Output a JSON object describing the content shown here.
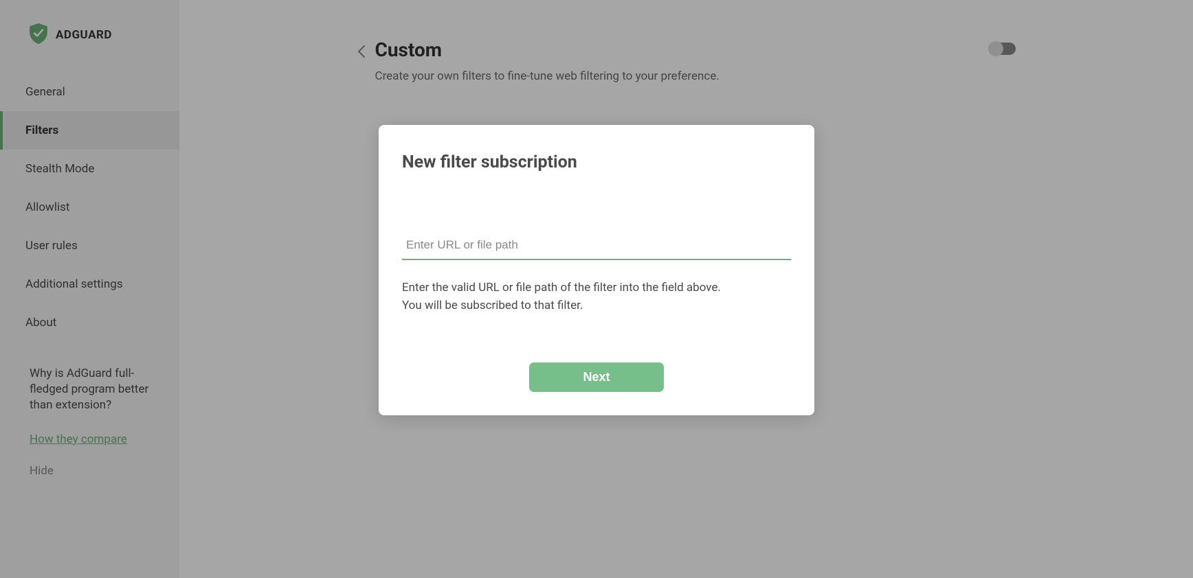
{
  "brand": {
    "name": "ADGUARD"
  },
  "sidebar": {
    "items": [
      {
        "label": "General"
      },
      {
        "label": "Filters"
      },
      {
        "label": "Stealth Mode"
      },
      {
        "label": "Allowlist"
      },
      {
        "label": "User rules"
      },
      {
        "label": "Additional settings"
      },
      {
        "label": "About"
      }
    ],
    "promo": {
      "text": "Why is AdGuard full-fledged program better than extension?",
      "compare_link": "How they compare",
      "hide_label": "Hide"
    }
  },
  "header": {
    "title": "Custom",
    "subtitle": "Create your own filters to fine-tune web filtering to your preference."
  },
  "modal": {
    "title": "New filter subscription",
    "input_placeholder": "Enter URL or file path",
    "help_text": "Enter the valid URL or file path of the filter into the field above.\nYou will be subscribed to that filter.",
    "next_label": "Next"
  }
}
